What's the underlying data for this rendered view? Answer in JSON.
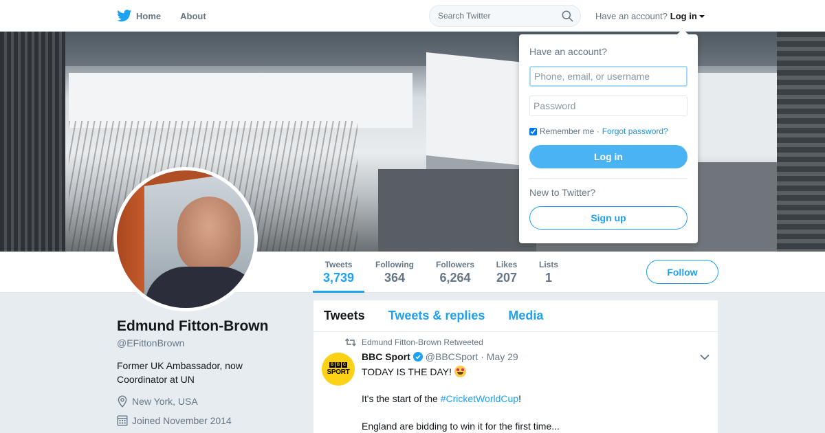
{
  "nav": {
    "home_label": "Home",
    "about_label": "About",
    "search_placeholder": "Search Twitter",
    "account_prompt": "Have an account?",
    "login_label": "Log in"
  },
  "colors": {
    "accent": "#1da1f2",
    "login_button": "#4ab3f4",
    "bbc_sport_yellow": "#fcd116"
  },
  "profile": {
    "name": "Edmund Fitton-Brown",
    "handle": "@EFittonBrown",
    "bio": "Former UK Ambassador, now Coordinator at UN",
    "location": "New York, USA",
    "joined": "Joined November 2014",
    "stats": [
      {
        "label": "Tweets",
        "value": "3,739"
      },
      {
        "label": "Following",
        "value": "364"
      },
      {
        "label": "Followers",
        "value": "6,264"
      },
      {
        "label": "Likes",
        "value": "207"
      },
      {
        "label": "Lists",
        "value": "1"
      }
    ],
    "follow_label": "Follow"
  },
  "timeline": {
    "tabs": [
      "Tweets",
      "Tweets & replies",
      "Media"
    ],
    "tweet": {
      "retweeted_by": "Edmund Fitton-Brown Retweeted",
      "author_name": "BBC Sport",
      "author_handle": "@BBCSport",
      "date": "· May 29",
      "avatar_text": {
        "b1": "B",
        "b2": "B",
        "b3": "C",
        "sport": "SPORT"
      },
      "line1": "TODAY IS THE DAY!",
      "line2_prefix": "It's the start of the ",
      "line2_hashtag": "#CricketWorldCup",
      "line2_suffix": "!",
      "line3": "England are bidding to win it for the first time..."
    }
  },
  "login_dropdown": {
    "title": "Have an account?",
    "username_placeholder": "Phone, email, or username",
    "password_placeholder": "Password",
    "remember_label": "Remember me ·",
    "forgot_label": "Forgot password?",
    "login_button": "Log in",
    "new_prompt": "New to Twitter?",
    "signup_button": "Sign up"
  },
  "icons": [
    "twitter-bird-icon",
    "home-icon",
    "search-icon",
    "location-icon",
    "calendar-icon",
    "retweet-icon",
    "verified-icon",
    "chevron-down-icon",
    "star-struck-emoji-icon"
  ]
}
